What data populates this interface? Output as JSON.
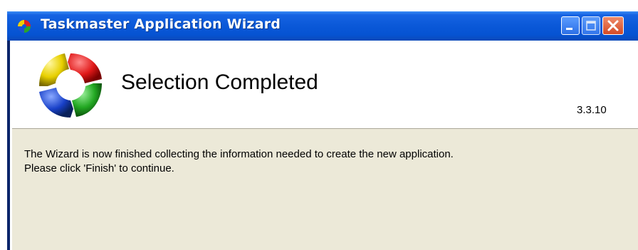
{
  "window": {
    "title": "Taskmaster Application Wizard",
    "title_icon": "taskmaster-logo-icon",
    "controls": {
      "minimize": "minimize-icon",
      "maximize": "maximize-icon",
      "close": "close-icon"
    }
  },
  "header": {
    "heading": "Selection Completed",
    "version": "3.3.10",
    "logo": "taskmaster-logo"
  },
  "body": {
    "line1": "The Wizard is now finished collecting the information needed to create the new application.",
    "line2": "Please click 'Finish' to continue."
  },
  "colors": {
    "titlebar": "#0a58d8",
    "client": "#ece9d8",
    "header": "#ffffff",
    "close_button": "#d44a25"
  }
}
